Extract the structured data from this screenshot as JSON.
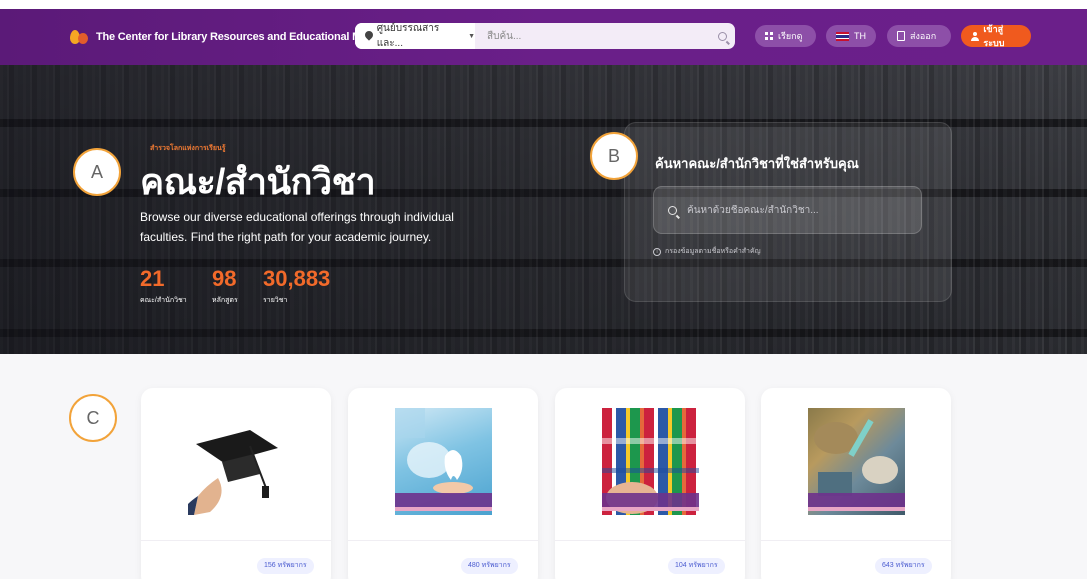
{
  "header": {
    "brand_name": "The Center for Library Resources and Educational Media",
    "search_scope": "ศูนย์บรรณสารและ...",
    "search_placeholder": "สืบค้น...",
    "browse_label": "เรียกดู",
    "lang_label": "TH",
    "export_label": "ส่งออก",
    "login_label": "เข้าสู่ระบบ",
    "colors": {
      "bar": "#6a1f89",
      "pill": "#8d4fa8",
      "login": "#f05a1e"
    }
  },
  "hero": {
    "eyebrow": "สำรวจโลกแห่งการเรียนรู้",
    "title": "คณะ/สำนักวิชา",
    "description": "Browse our diverse educational offerings through individual faculties. Find the right path for your academic journey.",
    "stats": [
      {
        "value": "21",
        "label": "คณะ/สำนักวิชา"
      },
      {
        "value": "98",
        "label": "หลักสูตร"
      },
      {
        "value": "30,883",
        "label": "รายวิชา"
      }
    ],
    "panel": {
      "title": "ค้นหาคณะ/สำนักวิชาที่ใช่สำหรับคุณ",
      "search_placeholder": "ค้นหาด้วยชื่อคณะ/สำนักวิชา...",
      "hint": "กรองข้อมูลตามชื่อหรือคำสำคัญ"
    },
    "accent_color": "#f26a2a"
  },
  "markers": [
    "A",
    "B",
    "C"
  ],
  "cards": [
    {
      "image": "graduation-cap-image",
      "resources": "156 ทรัพยากร"
    },
    {
      "image": "dentistry-image",
      "resources": "480 ทรัพยากร"
    },
    {
      "image": "world-flags-image",
      "resources": "104 ทรัพยากร"
    },
    {
      "image": "veterinary-image",
      "resources": "643 ทรัพยากร"
    }
  ]
}
